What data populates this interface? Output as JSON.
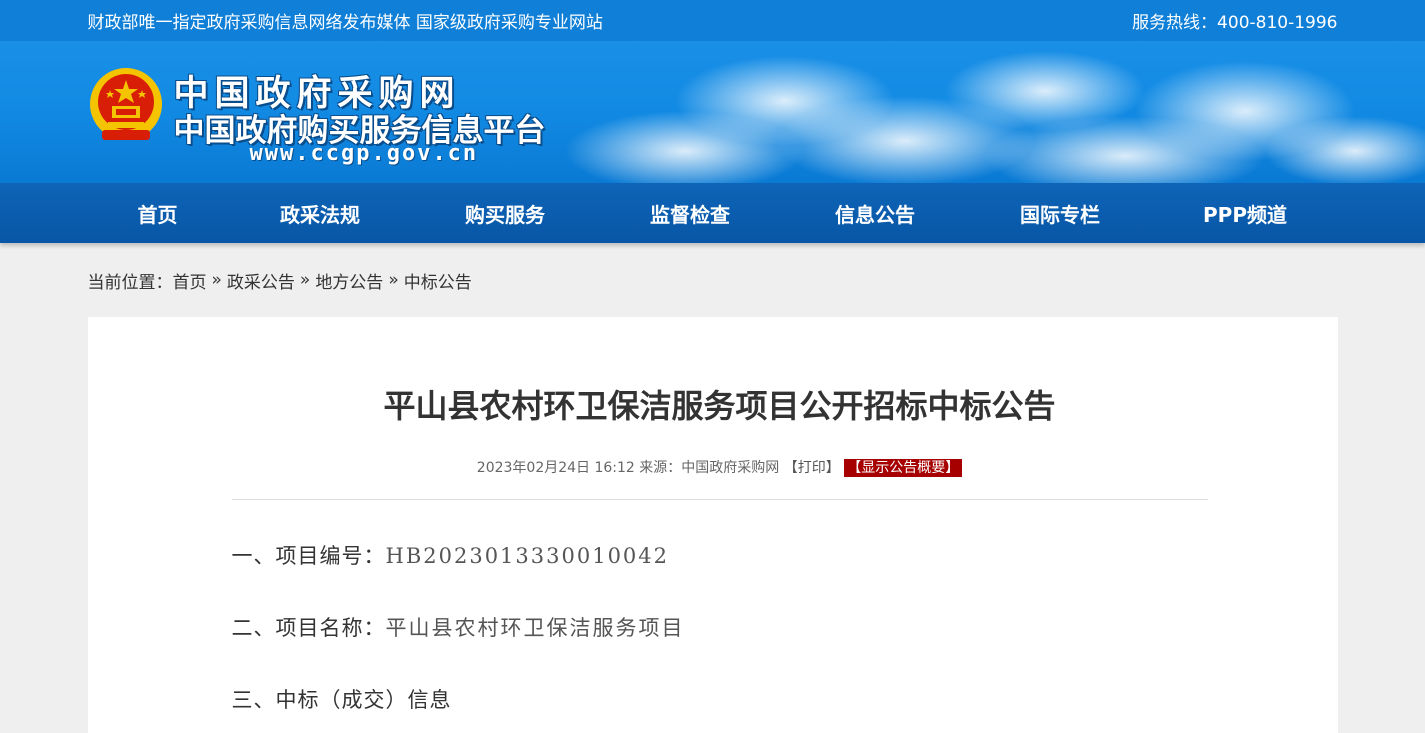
{
  "topbar": {
    "left_text": "财政部唯一指定政府采购信息网络发布媒体 国家级政府采购专业网站",
    "hotline": "服务热线：400-810-1996"
  },
  "banner": {
    "logo_line1": "中国政府采购网",
    "logo_line2": "中国政府购买服务信息平台",
    "logo_url": "www.ccgp.gov.cn"
  },
  "nav": {
    "items": [
      {
        "label": "首页"
      },
      {
        "label": "政采法规"
      },
      {
        "label": "购买服务"
      },
      {
        "label": "监督检查"
      },
      {
        "label": "信息公告"
      },
      {
        "label": "国际专栏"
      },
      {
        "label": "PPP频道"
      }
    ]
  },
  "breadcrumb": {
    "prefix": "当前位置：",
    "items": [
      "首页",
      "政采公告",
      "地方公告",
      "中标公告"
    ],
    "separator": "»"
  },
  "article": {
    "title": "平山县农村环卫保洁服务项目公开招标中标公告",
    "meta_date": "2023年02月24日 16:12 来源：",
    "meta_source": "中国政府采购网",
    "print_label": "【打印】",
    "summary_label": "【显示公告概要】",
    "sections": [
      {
        "label": "一、项目编号：",
        "value": "HB2023013330010042"
      },
      {
        "label": "二、项目名称：",
        "value": "平山县农村环卫保洁服务项目"
      },
      {
        "label": "三、中标（成交）信息",
        "value": ""
      }
    ]
  },
  "colors": {
    "topbar": "#0f7fd7",
    "nav": "#0a5fb0",
    "summary_badge": "#a60000"
  }
}
